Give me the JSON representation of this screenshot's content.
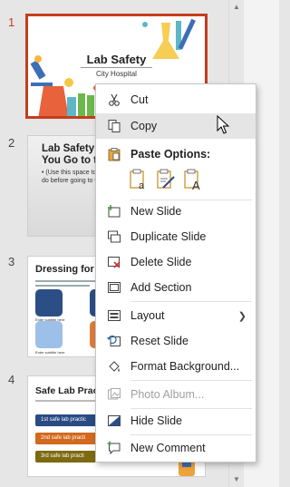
{
  "slides": [
    {
      "number": "1",
      "title": "Lab Safety",
      "subtitle": "City Hospital"
    },
    {
      "number": "2",
      "title_line1": "Lab Safety Be",
      "title_line2": "You Go to the",
      "text_line1": "• (Use this space to list",
      "text_line2": "do before going to th"
    },
    {
      "number": "3",
      "title": "Dressing for Lab",
      "tile_label": "Enter subtitle here"
    },
    {
      "number": "4",
      "title": "Safe Lab Practic",
      "practices": [
        "1st safe lab practic",
        "2nd safe lab practi",
        "3rd safe lab practi"
      ]
    }
  ],
  "context_menu": {
    "cut": "Cut",
    "copy": "Copy",
    "paste_options": "Paste Options:",
    "new_slide": "New Slide",
    "duplicate_slide": "Duplicate Slide",
    "delete_slide": "Delete Slide",
    "add_section": "Add Section",
    "layout": "Layout",
    "reset_slide": "Reset Slide",
    "format_background": "Format Background...",
    "photo_album": "Photo Album...",
    "hide_slide": "Hide Slide",
    "new_comment": "New Comment"
  },
  "colors": {
    "accent": "#c43e1c",
    "tile_dark_blue": "#2b4e86",
    "tile_orange": "#e07b39",
    "tile_light_blue": "#9cc0e7",
    "practice_blue": "#284b83",
    "practice_orange": "#d2691e",
    "practice_olive": "#7e6a10"
  },
  "icons": [
    "scissors-icon",
    "copy-icon",
    "clipboard-icon",
    "paste-keep-formatting-icon",
    "paste-picture-icon",
    "paste-text-only-icon",
    "new-slide-icon",
    "duplicate-slide-icon",
    "delete-slide-icon",
    "add-section-icon",
    "layout-icon",
    "reset-slide-icon",
    "format-background-icon",
    "photo-album-icon",
    "hide-slide-icon",
    "new-comment-icon",
    "chevron-right-icon",
    "chevron-up-icon",
    "chevron-down-icon",
    "mouse-pointer-icon"
  ]
}
